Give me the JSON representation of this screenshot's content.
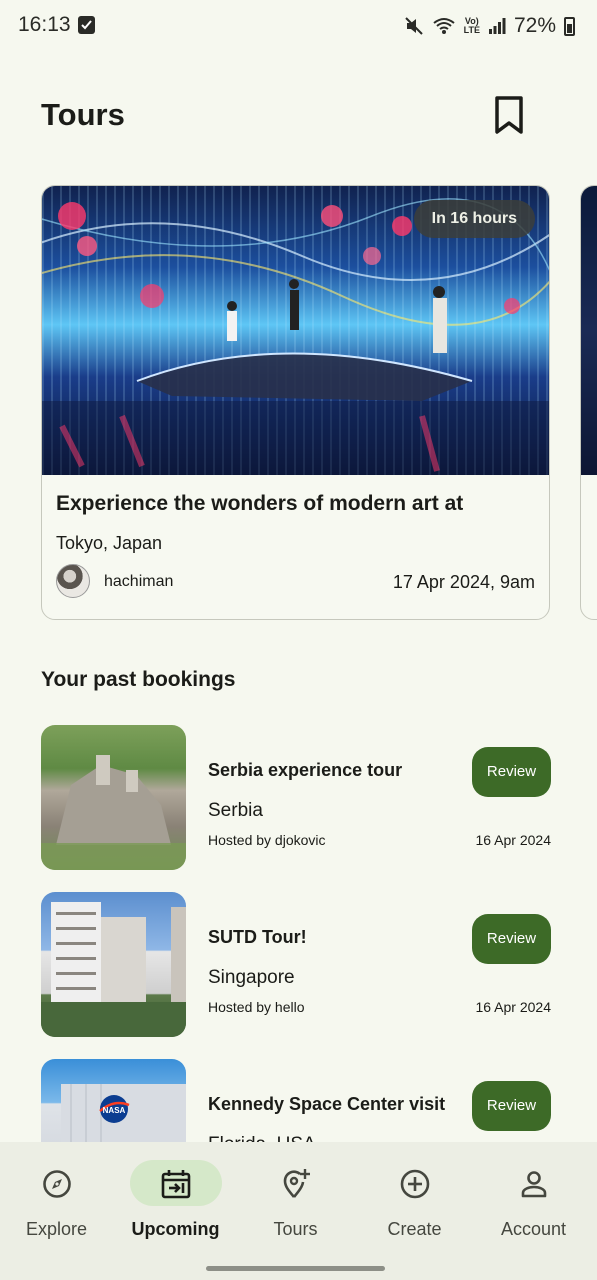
{
  "status_bar": {
    "time": "16:13",
    "battery_percent": "72%",
    "lte_top": "Vo)",
    "lte_bottom": "LTE"
  },
  "header": {
    "title": "Tours",
    "bookmark_icon": "bookmark-icon"
  },
  "featured": {
    "badge": "In 16 hours",
    "title": "Experience the wonders of modern art at",
    "location": "Tokyo, Japan",
    "host": "hachiman",
    "date": "17 Apr 2024, 9am"
  },
  "past_bookings": {
    "title": "Your past bookings",
    "items": [
      {
        "name": "Serbia experience tour",
        "country": "Serbia",
        "host": "Hosted by djokovic",
        "date": "16 Apr 2024",
        "action": "Review"
      },
      {
        "name": "SUTD Tour!",
        "country": "Singapore",
        "host": "Hosted by hello",
        "date": "16 Apr 2024",
        "action": "Review"
      },
      {
        "name": "Kennedy Space Center visit",
        "country": "Florida, USA",
        "host": "",
        "date": "",
        "action": "Review"
      }
    ]
  },
  "nav": {
    "items": [
      {
        "label": "Explore",
        "icon": "compass-icon"
      },
      {
        "label": "Upcoming",
        "icon": "calendar-arrow-icon",
        "active": true
      },
      {
        "label": "Tours",
        "icon": "location-add-icon"
      },
      {
        "label": "Create",
        "icon": "plus-circle-icon"
      },
      {
        "label": "Account",
        "icon": "person-icon"
      }
    ]
  },
  "colors": {
    "background": "#f6f8ef",
    "accent": "#3d6a27",
    "nav_active_pill": "#d5e8c9"
  }
}
